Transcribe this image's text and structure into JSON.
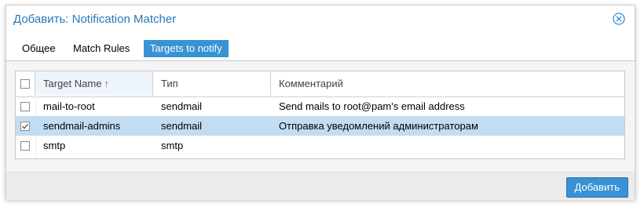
{
  "dialog": {
    "title": "Добавить: Notification Matcher",
    "close_icon": "close-circle-icon"
  },
  "tabs": [
    {
      "label": "Общее",
      "active": false
    },
    {
      "label": "Match Rules",
      "active": false
    },
    {
      "label": "Targets to notify",
      "active": true
    }
  ],
  "grid": {
    "columns": {
      "name": "Target Name",
      "type": "Тип",
      "comment": "Комментарий",
      "sort_indicator": "↑"
    },
    "rows": [
      {
        "name": "mail-to-root",
        "type": "sendmail",
        "comment": "Send mails to root@pam's email address",
        "checked": false
      },
      {
        "name": "sendmail-admins",
        "type": "sendmail",
        "comment": "Отправка уведомлений администраторам",
        "checked": true
      },
      {
        "name": "smtp",
        "type": "smtp",
        "comment": "",
        "checked": false
      }
    ]
  },
  "footer": {
    "add_button": "Добавить"
  },
  "colors": {
    "accent": "#3892d4",
    "title": "#2979b5",
    "selected_row": "#c2ddf2"
  }
}
